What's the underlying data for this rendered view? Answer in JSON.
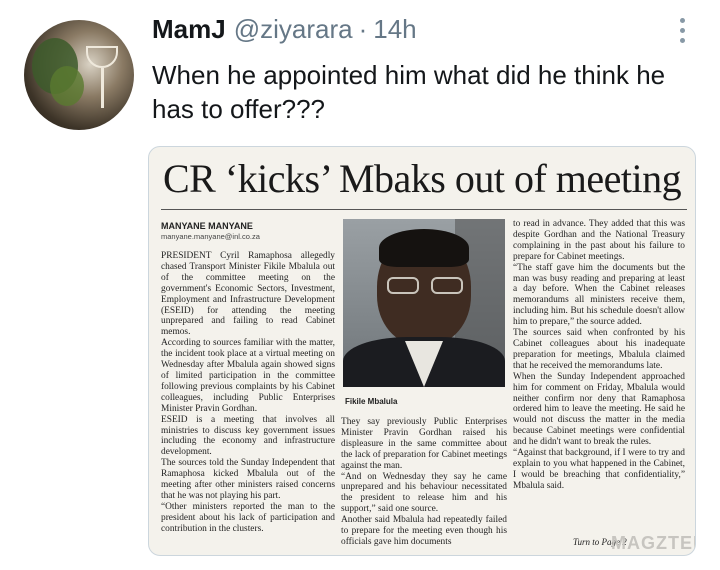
{
  "tweet": {
    "display_name": "MamJ",
    "handle": "@ziyarara",
    "separator": "·",
    "time": "14h",
    "text": "When he appointed him what did he think he has to offer???",
    "menu_icon": "more-vertical-icon"
  },
  "article": {
    "headline": "CR ‘kicks’ Mbaks out of meeting",
    "byline": "MANYANE MANYANE",
    "email": "manyane.manyane@inl.co.za",
    "col1": "PRESIDENT Cyril Ramaphosa allegedly chased Transport Minister Fikile Mbalula out of the committee meeting on the government's Economic Sectors, Investment, Employment and Infrastructure Development (ESEID) for attending the meeting unprepared and failing to read Cabinet memos.\n    According to sources familiar with the matter, the incident took place at a virtual meeting on Wednesday after Mbalula again showed signs of limited participation in the committee following previous complaints by his Cabinet colleagues, including Public Enterprises Minister Pravin Gordhan.\n    ESEID is a meeting that involves all ministries to discuss key government issues including the economy and infrastructure development.\n    The sources told the Sunday Independent that Ramaphosa kicked Mbalula out of the meeting after other ministers raised concerns that he was not playing his part.\n    “Other ministers reported the man to the president about his lack of participation and contribution in the clusters.",
    "col2": "They say previously Public Enterprises Minister Pravin Gordhan raised his displeasure in the same committee about the lack of preparation for Cabinet meetings against the man.\n    “And on Wednesday they say he came unprepared and his behaviour necessitated the president to release him and his support,” said one source.\n    Another said Mbalula had repeatedly failed to prepare for the meeting even though his officials gave him documents",
    "col3": "to read in advance. They added that this was despite Gordhan and the National Treasury complaining in the past about his failure to prepare for Cabinet meetings.\n    “The staff gave him the documents but the man was busy reading and preparing at least a day before. When the Cabinet releases memorandums all ministers receive them, including him. But his schedule doesn't allow him to prepare,” the source added.\n    The sources said when confronted by his Cabinet colleagues about his inadequate preparation for meetings, Mbalula claimed that he received the memorandums late.\n    When the Sunday Independent approached him for comment on Friday, Mbalula would neither confirm nor deny that Ramaphosa ordered him to leave the meeting. He said he would not discuss the matter in the media because Cabinet meetings were confidential and he didn't want to break the rules.\n    “Against that background, if I were to try and explain to you what happened in the Cabinet, I would be breaching that confidentiality,” Mbalula said.",
    "photo_caption": "Fikile Mbalula",
    "turn_to": "Turn to Page 2",
    "watermark": "MAGZTER"
  }
}
